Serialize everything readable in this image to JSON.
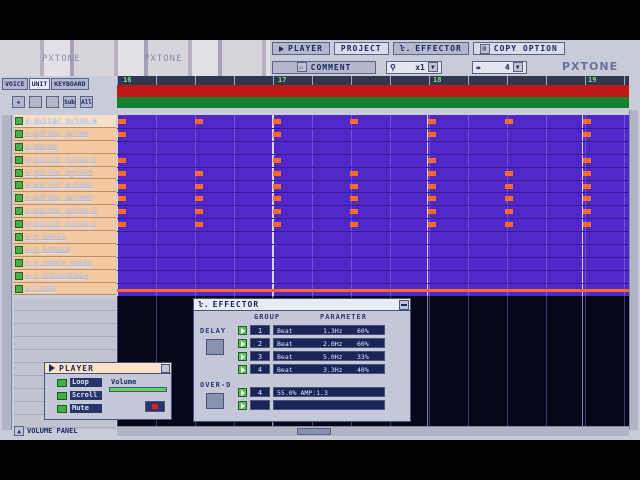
{
  "top_tabs": [
    {
      "label": "PLAYER",
      "active": false
    },
    {
      "label": "PROJECT",
      "active": true
    },
    {
      "label": "EFFECTOR",
      "active": false
    },
    {
      "label": "COPY OPTION",
      "active": true
    }
  ],
  "comment_label": "COMMENT",
  "zoom_label": "x1",
  "snap_value": "4",
  "brand": "PXTONE",
  "logo_text": "PXTONE",
  "left_tabs": [
    {
      "label": "VOICE",
      "active": false
    },
    {
      "label": "UNIT",
      "active": true
    },
    {
      "label": "KEYBOARD",
      "active": false
    }
  ],
  "tools": [
    "",
    "",
    "",
    "Sub",
    "All"
  ],
  "units": [
    "u-guitar_nylon-m",
    "u-guitar_nylon",
    "u-bass8",
    "u-guitar_nylon-2",
    "u-guitar_nylon2",
    "u-guitar_nylon2",
    "u-guitar_nylon2",
    "u-guitar_nylon-2",
    "u-guitar_nylon-2",
    "u-p_bass2",
    "u-p_hihatd",
    "u-p_snare_noms2",
    "u-p_hihatd1big",
    "u-tvohl"
  ],
  "ruler_marks": [
    "16",
    "17",
    "18",
    "19"
  ],
  "volume_panel_label": "VOLUME PANEL",
  "effector": {
    "title": "EFFECTOR",
    "group_header": "GROUP",
    "param_header": "PARAMETER",
    "delay_label": "DELAY",
    "overd_label": "OVER-D",
    "delay_rows": [
      {
        "group": "1",
        "type": "Beat",
        "freq": "1.3Hz",
        "rate": "60%"
      },
      {
        "group": "2",
        "type": "Beat",
        "freq": "2.0Hz",
        "rate": "60%"
      },
      {
        "group": "3",
        "type": "Beat",
        "freq": "5.0Hz",
        "rate": "33%"
      },
      {
        "group": "4",
        "type": "Beat",
        "freq": "3.3Hz",
        "rate": "40%"
      }
    ],
    "overdrive_rows": [
      {
        "group": "4",
        "param": "55.0% AMP:1.3"
      },
      {
        "group": "",
        "param": ""
      }
    ]
  },
  "player": {
    "title": "PLAYER",
    "volume_label": "Volume",
    "volume_level": 1.0,
    "buttons": [
      "Loop",
      "Scroll",
      "Mute"
    ]
  },
  "colors": {
    "grid_bg": "#5028c8",
    "note": "#ff6a2a",
    "red_band": "#c01818",
    "green_band": "#128030"
  }
}
